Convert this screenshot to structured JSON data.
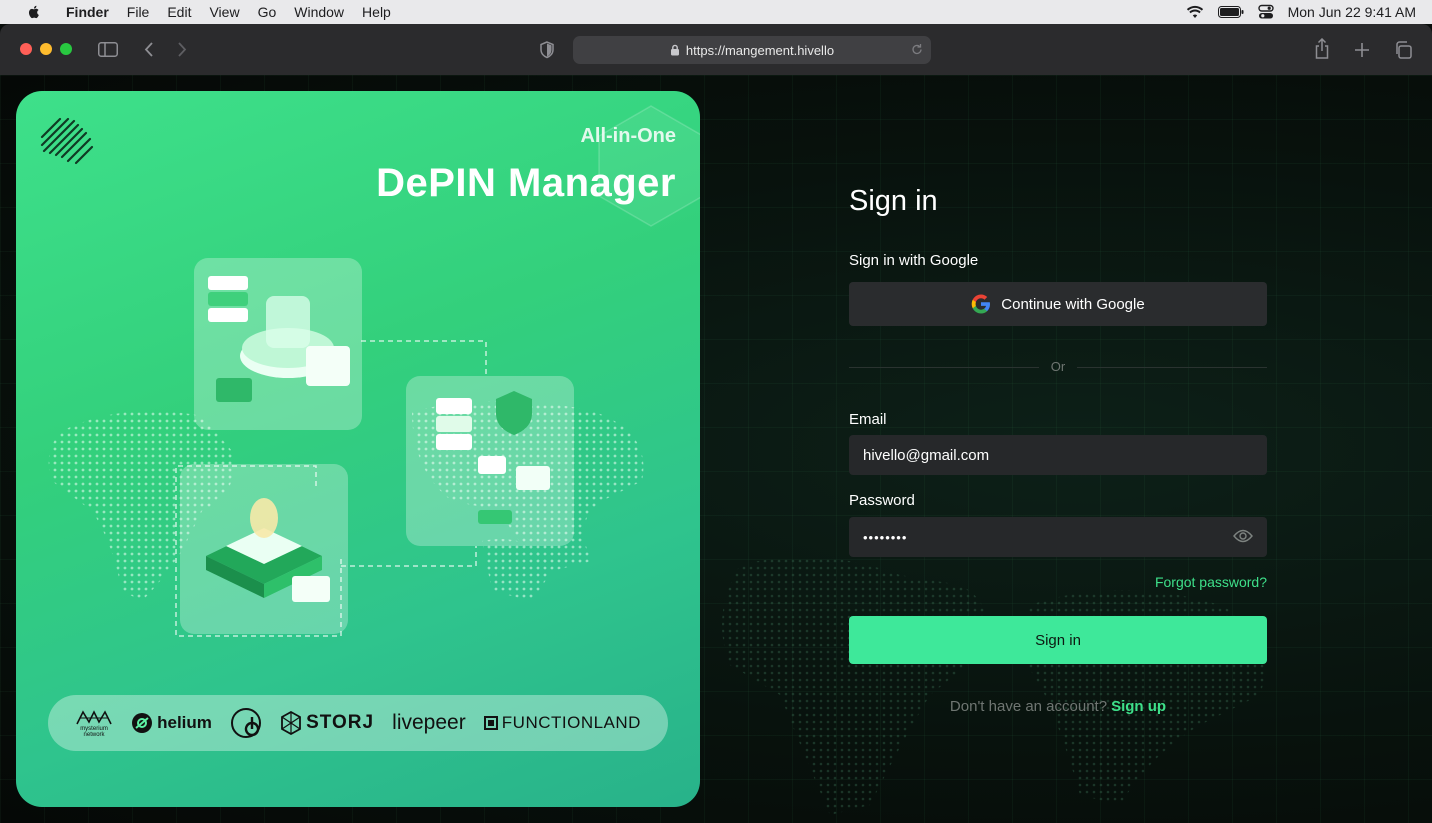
{
  "menubar": {
    "app_name": "Finder",
    "items": [
      "File",
      "Edit",
      "View",
      "Go",
      "Window",
      "Help"
    ],
    "datetime": "Mon Jun 22  9:41 AM"
  },
  "browser": {
    "url": "https://mangement.hivello"
  },
  "hero": {
    "subtitle": "All-in-One",
    "title": "DePIN Manager",
    "partners": {
      "mysterium_line1": "mysterium",
      "mysterium_line2": "network",
      "helium": "helium",
      "storj": "STORJ",
      "livepeer": "livepeer",
      "functionland": "FUNCTIONLAND"
    }
  },
  "form": {
    "heading": "Sign in",
    "google_label": "Sign in with Google",
    "google_button": "Continue with Google",
    "or": "Or",
    "email_label": "Email",
    "email_value": "hivello@gmail.com",
    "password_label": "Password",
    "password_value": "••••••••",
    "forgot": "Forgot password?",
    "submit": "Sign in",
    "signup_prompt": "Don't have an account?",
    "signup_link": "Sign up"
  },
  "colors": {
    "accent": "#3ee89a",
    "link": "#3ee08a",
    "input_bg": "#26282a"
  }
}
